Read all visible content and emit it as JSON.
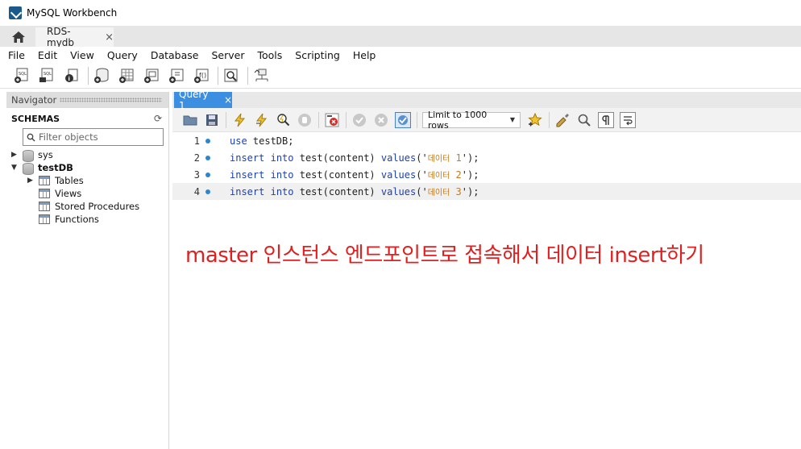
{
  "window": {
    "title": "MySQL Workbench"
  },
  "connection_tab": {
    "label": "RDS-mydb",
    "close": "×"
  },
  "menu": [
    "File",
    "Edit",
    "View",
    "Query",
    "Database",
    "Server",
    "Tools",
    "Scripting",
    "Help"
  ],
  "navigator": {
    "header": "Navigator",
    "schemas_label": "SCHEMAS",
    "filter_placeholder": "Filter objects",
    "schemas": [
      {
        "name": "sys",
        "expanded": false
      },
      {
        "name": "testDB",
        "expanded": true,
        "children": [
          "Tables",
          "Views",
          "Stored Procedures",
          "Functions"
        ]
      }
    ]
  },
  "editor": {
    "tab_label": "Query 1",
    "tab_close": "×",
    "limit_label": "Limit to 1000 rows",
    "lines": [
      {
        "no": "1",
        "kw1": "use",
        "rest": " testDB;"
      },
      {
        "no": "2",
        "kw1": "insert",
        "kw2": "into",
        "mid": " test(content) ",
        "kw3": "values",
        "str_open": "('",
        "str_kr": "데이터",
        "str_num": " 1",
        "str_close": "');"
      },
      {
        "no": "3",
        "kw1": "insert",
        "kw2": "into",
        "mid": " test(content) ",
        "kw3": "values",
        "str_open": "('",
        "str_kr": "데이터",
        "str_num": " 2",
        "str_close": "');"
      },
      {
        "no": "4",
        "kw1": "insert",
        "kw2": "into",
        "mid": " test(content) ",
        "kw3": "values",
        "str_open": "('",
        "str_kr": "데이터",
        "str_num": " 3",
        "str_close": "');"
      }
    ]
  },
  "annotation": "master 인스턴스 엔드포인트로 접속해서 데이터 insert하기",
  "colors": {
    "accent_tab": "#3b8ee0",
    "keyword": "#1c3fb3",
    "string": "#c47a20",
    "annotation": "#e02020"
  }
}
